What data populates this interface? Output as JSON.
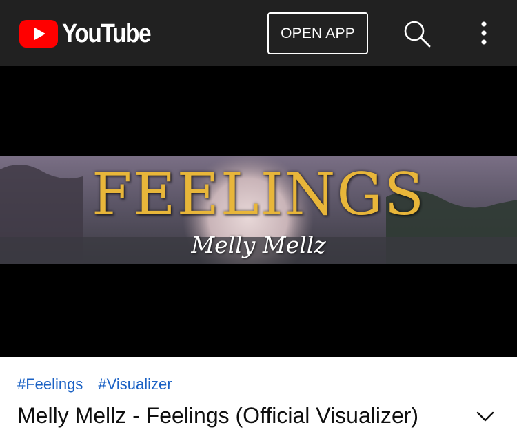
{
  "header": {
    "logo_text": "YouTube",
    "open_app_label": "OPEN APP",
    "search_icon": "search-icon",
    "more_icon": "more-vert-icon",
    "background_color": "#212121",
    "brand_color": "#ff0000"
  },
  "video": {
    "title_overlay": "FEELINGS",
    "artist_overlay": "Melly Mellz",
    "title_color": "#e8b63a"
  },
  "info": {
    "hashtags": [
      "#Feelings",
      "#Visualizer"
    ],
    "title": "Melly Mellz - Feelings (Official Visualizer)",
    "expand_icon": "chevron-down-icon",
    "hashtag_color": "#1a61c4"
  }
}
